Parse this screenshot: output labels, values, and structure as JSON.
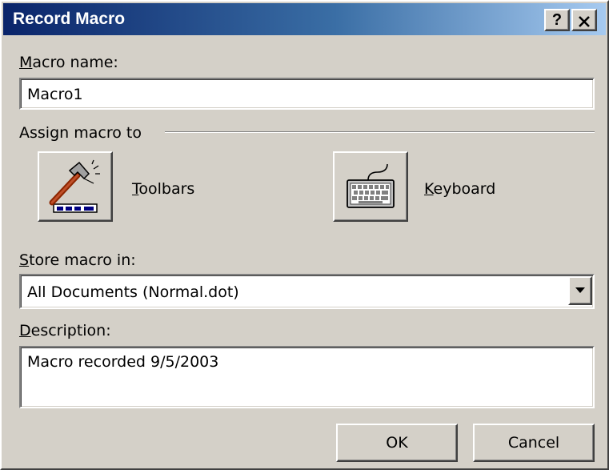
{
  "window": {
    "title": "Record Macro",
    "help_glyph": "?",
    "close_glyph": "✕"
  },
  "macro_name": {
    "label": "Macro name:",
    "label_access_key": "M",
    "label_rest": "acro name:",
    "value": "Macro1"
  },
  "assign": {
    "group_label": "Assign macro to",
    "toolbars": {
      "access_key": "T",
      "rest": "oolbars",
      "icon": "hammer-toolbar-icon"
    },
    "keyboard": {
      "access_key": "K",
      "rest": "eyboard",
      "icon": "keyboard-icon"
    }
  },
  "store_in": {
    "label_access_key": "S",
    "label_rest": "tore macro in:",
    "selected": "All Documents (Normal.dot)"
  },
  "description": {
    "label_access_key": "D",
    "label_rest": "escription:",
    "value": "Macro recorded 9/5/2003"
  },
  "buttons": {
    "ok": "OK",
    "cancel": "Cancel"
  },
  "colors": {
    "title_gradient_start": "#0a246a",
    "title_gradient_end": "#a6caf0",
    "face": "#d4d0c8"
  }
}
